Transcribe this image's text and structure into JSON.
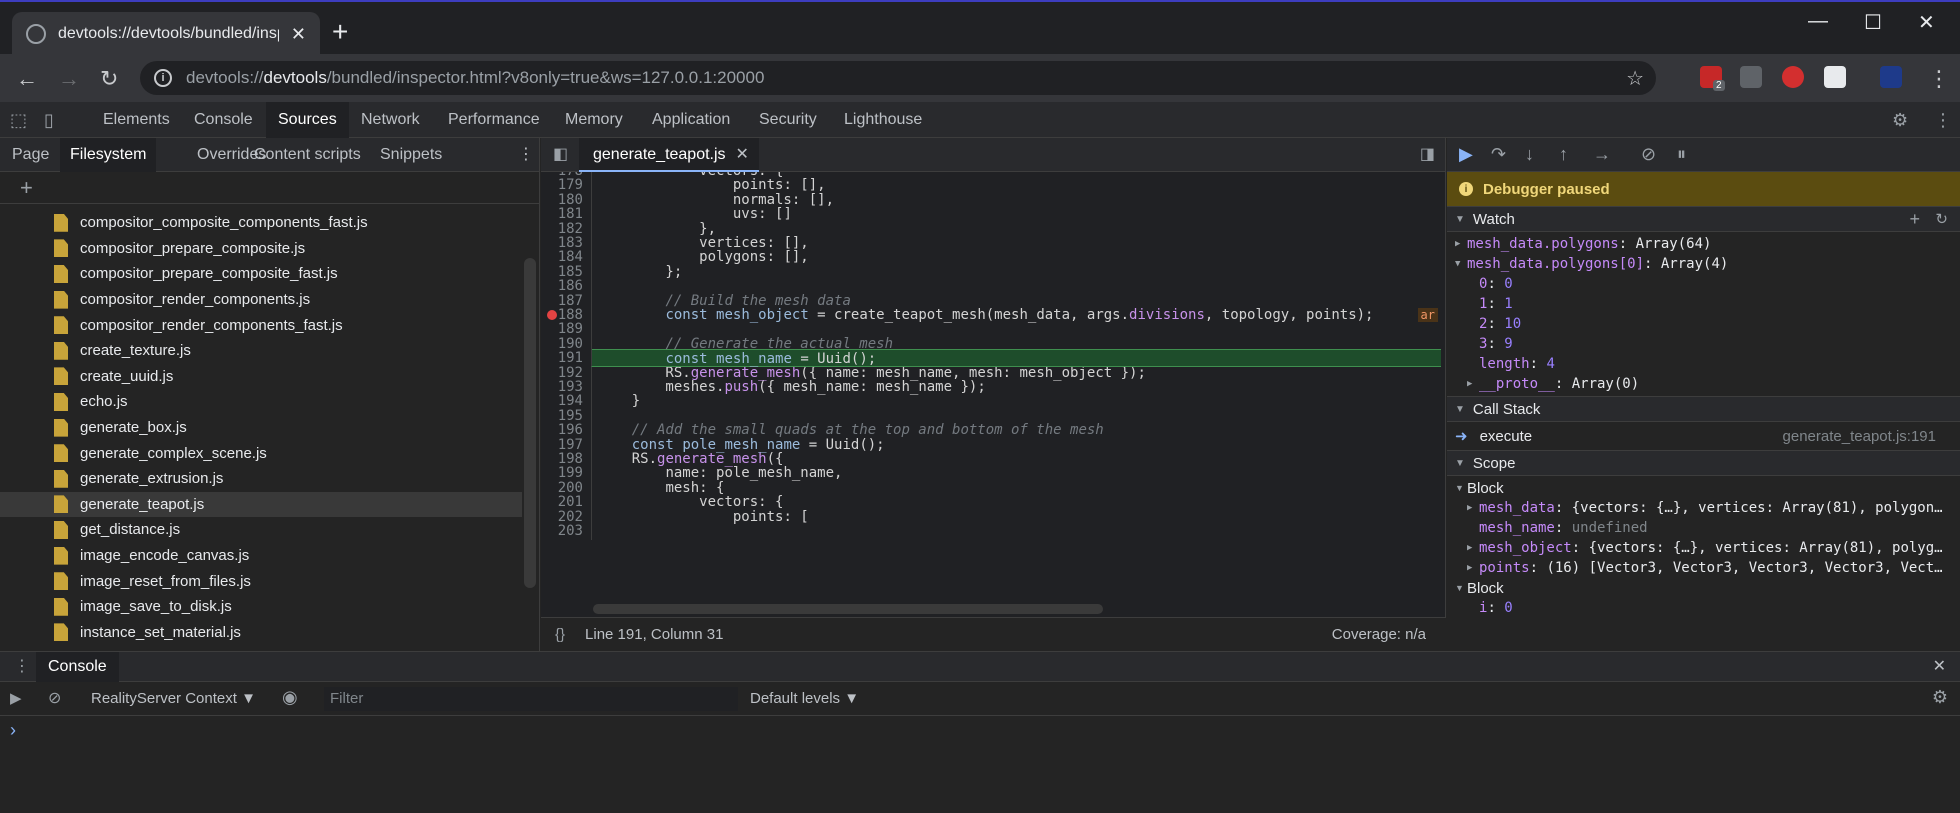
{
  "browser": {
    "tab_title": "devtools://devtools/bundled/insp",
    "url_prefix": "devtools://",
    "url_host": "devtools",
    "url_rest": "/bundled/inspector.html?v8only=true&ws=127.0.0.1:20000",
    "ext_badge": "2"
  },
  "devtools": {
    "tabs": [
      "Elements",
      "Console",
      "Sources",
      "Network",
      "Performance",
      "Memory",
      "Application",
      "Security",
      "Lighthouse"
    ],
    "active_tab": "Sources"
  },
  "navigator": {
    "tabs": [
      "Page",
      "Filesystem",
      "Overrides",
      "Content scripts",
      "Snippets"
    ],
    "active_tab": "Filesystem",
    "files": [
      "compositor_composite_components_fast.js",
      "compositor_prepare_composite.js",
      "compositor_prepare_composite_fast.js",
      "compositor_render_components.js",
      "compositor_render_components_fast.js",
      "create_texture.js",
      "create_uuid.js",
      "echo.js",
      "generate_box.js",
      "generate_complex_scene.js",
      "generate_extrusion.js",
      "generate_teapot.js",
      "get_distance.js",
      "image_encode_canvas.js",
      "image_reset_from_files.js",
      "image_save_to_disk.js",
      "instance_set_material.js"
    ],
    "selected_file": "generate_teapot.js"
  },
  "editor": {
    "file_tab": "generate_teapot.js",
    "status_position": "Line 191, Column 31",
    "coverage": "Coverage: n/a",
    "inline_value": "ar"
  },
  "debugger": {
    "paused_label": "Debugger paused",
    "watch_title": "Watch",
    "watch": [
      {
        "name": "mesh_data.polygons",
        "value": "Array(64)",
        "expanded": false
      },
      {
        "name": "mesh_data.polygons[0]",
        "value": "Array(4)",
        "expanded": true
      }
    ],
    "watch_children": [
      {
        "key": "0",
        "val": "0"
      },
      {
        "key": "1",
        "val": "1"
      },
      {
        "key": "2",
        "val": "10"
      },
      {
        "key": "3",
        "val": "9"
      },
      {
        "key": "length",
        "val": "4"
      }
    ],
    "proto_key": "__proto__",
    "proto_val": "Array(0)",
    "callstack_title": "Call Stack",
    "frame_name": "execute",
    "frame_location": "generate_teapot.js:191",
    "scope_title": "Scope",
    "block_label": "Block",
    "scope_rows": [
      {
        "name": "mesh_data",
        "value": "{vectors: {…}, vertices: Array(81), polygon…",
        "arrow": true
      },
      {
        "name": "mesh_name",
        "value": "undefined",
        "arrow": false
      },
      {
        "name": "mesh_object",
        "value": "{vectors: {…}, vertices: Array(81), polyg…",
        "arrow": true
      },
      {
        "name": "points",
        "value": "(16) [Vector3, Vector3, Vector3, Vector3, Vect…",
        "arrow": true
      }
    ],
    "block2_label": "Block",
    "block2_row_name": "i",
    "block2_row_val": "0"
  },
  "console": {
    "tab": "Console",
    "context": "RealityServer Context",
    "filter_placeholder": "Filter",
    "levels": "Default levels",
    "prompt": "›"
  }
}
